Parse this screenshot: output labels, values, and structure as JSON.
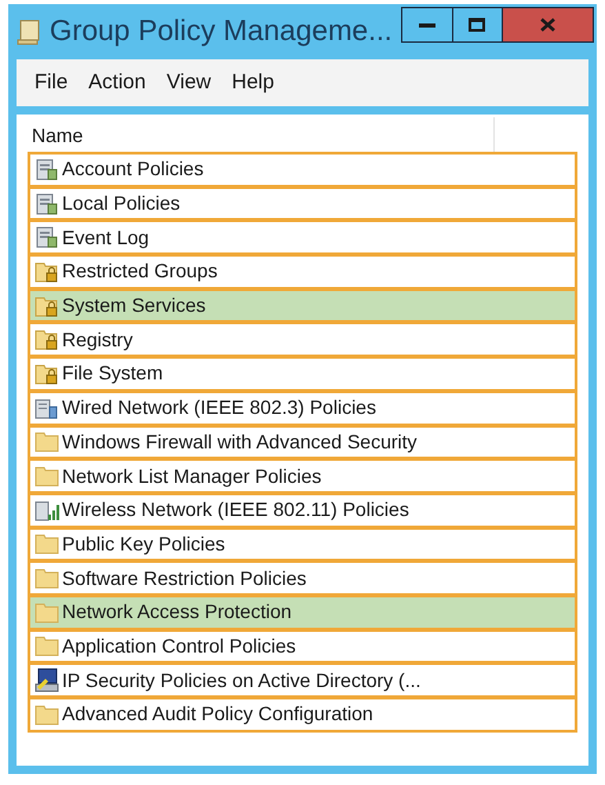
{
  "window": {
    "title": "Group Policy Manageme...",
    "controls": [
      {
        "kind": "minimize"
      },
      {
        "kind": "maximize"
      },
      {
        "kind": "close"
      }
    ]
  },
  "menu": [
    "File",
    "Action",
    "View",
    "Help"
  ],
  "table": {
    "columns": [
      "Name"
    ],
    "rows": [
      {
        "name": "Account Policies",
        "kind": "document",
        "selected": false
      },
      {
        "name": "Local Policies",
        "kind": "document",
        "selected": false
      },
      {
        "name": "Event Log",
        "kind": "document",
        "selected": false
      },
      {
        "name": "Restricted Groups",
        "kind": "lockfolder",
        "selected": false
      },
      {
        "name": "System Services",
        "kind": "lockfolder",
        "selected": true
      },
      {
        "name": "Registry",
        "kind": "lockfolder",
        "selected": false
      },
      {
        "name": "File System",
        "kind": "lockfolder",
        "selected": false
      },
      {
        "name": "Wired Network (IEEE 802.3) Policies",
        "kind": "network",
        "selected": false
      },
      {
        "name": "Windows Firewall with Advanced Security",
        "kind": "folder",
        "selected": false
      },
      {
        "name": "Network List Manager Policies",
        "kind": "folder",
        "selected": false
      },
      {
        "name": "Wireless Network (IEEE 802.11) Policies",
        "kind": "wireless",
        "selected": false
      },
      {
        "name": "Public Key Policies",
        "kind": "folder",
        "selected": false
      },
      {
        "name": "Software Restriction Policies",
        "kind": "folder",
        "selected": false
      },
      {
        "name": "Network Access Protection",
        "kind": "folder",
        "selected": true
      },
      {
        "name": "Application Control Policies",
        "kind": "folder",
        "selected": false
      },
      {
        "name": "IP Security Policies on Active Directory (...",
        "kind": "computer",
        "selected": false
      },
      {
        "name": "Advanced Audit Policy Configuration",
        "kind": "folder",
        "selected": false
      }
    ]
  }
}
